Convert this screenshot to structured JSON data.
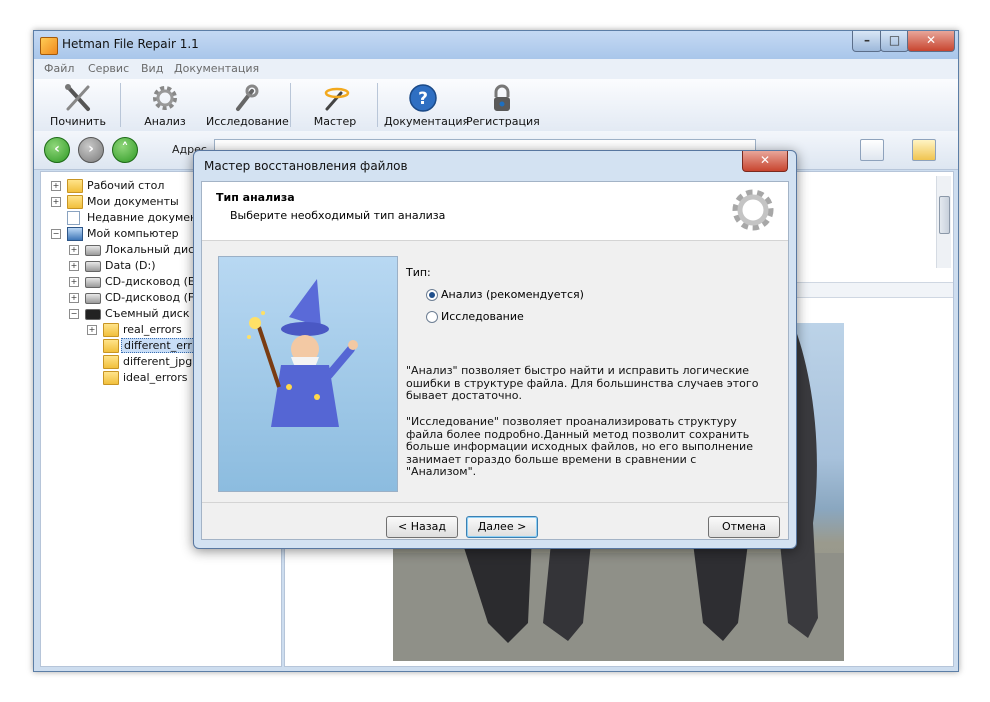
{
  "window": {
    "title": "Hetman File Repair 1.1"
  },
  "menu": [
    "Файл",
    "Сервис",
    "Вид",
    "Документация"
  ],
  "toolbar": [
    {
      "label": "Починить",
      "icon": "repair-tools-icon"
    },
    {
      "label": "Анализ",
      "icon": "gear-icon"
    },
    {
      "label": "Исследование",
      "icon": "wrench-gear-icon"
    },
    {
      "label": "Мастер",
      "icon": "magic-wand-icon"
    },
    {
      "label": "Документация",
      "icon": "help-icon"
    },
    {
      "label": "Регистрация",
      "icon": "lock-icon"
    }
  ],
  "nav": {
    "address_label": "Адрес"
  },
  "tree": [
    {
      "label": "Рабочий стол"
    },
    {
      "label": "Мои документы"
    },
    {
      "label": "Недавние документ"
    },
    {
      "label": "Мой компьютер"
    },
    {
      "label": "Локальный дис"
    },
    {
      "label": "Data (D:)"
    },
    {
      "label": "CD-дисковод (E"
    },
    {
      "label": "CD-дисковод (F"
    },
    {
      "label": "Съемный диск ("
    },
    {
      "label": "real_errors"
    },
    {
      "label": "different_err"
    },
    {
      "label": "different_jpg"
    },
    {
      "label": "ideal_errors"
    }
  ],
  "dialog": {
    "title": "Мастер восстановления файлов",
    "close_label": "✕",
    "header_title": "Тип анализа",
    "header_subtitle": "Выберите необходимый тип анализа",
    "type_label": "Тип:",
    "options": [
      {
        "label": "Анализ (рекомендуется)",
        "selected": true
      },
      {
        "label": "Исследование",
        "selected": false
      }
    ],
    "desc1": "\"Анализ\" позволяет быстро найти и исправить логические ошибки в структуре файла. Для большинства случаев этого бывает достаточно.",
    "desc2": "\"Исследование\" позволяет проанализировать структуру файла более подробно.Данный метод позволит сохранить больше информации исходных файлов, но его выполнение занимает гораздо больше времени в сравнении с \"Анализом\".",
    "back_label": "< Назад",
    "next_label": "Далее >",
    "cancel_label": "Отмена"
  }
}
